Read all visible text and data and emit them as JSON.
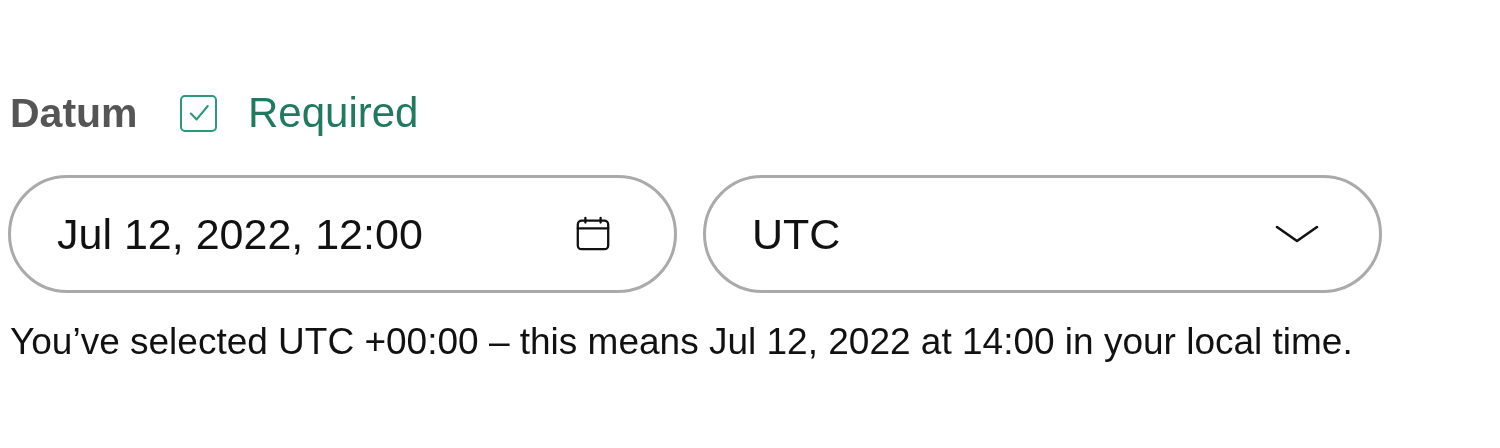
{
  "label": "Datum",
  "required": {
    "label": "Required",
    "checked": true
  },
  "date_field": {
    "value": "Jul 12, 2022, 12:00"
  },
  "timezone_select": {
    "value": "UTC"
  },
  "hint": "You’ve selected UTC +00:00 – this means Jul 12, 2022 at 14:00 in your local time."
}
